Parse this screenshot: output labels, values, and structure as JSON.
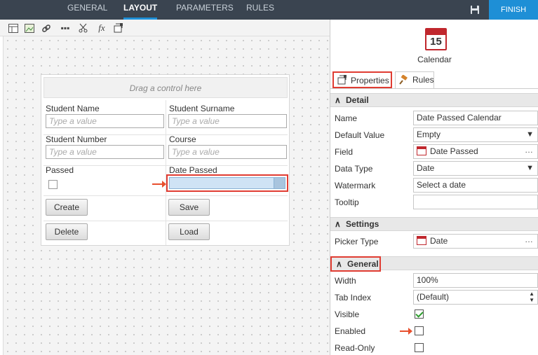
{
  "top_tabs": [
    "GENERAL",
    "LAYOUT",
    "PARAMETERS",
    "RULES"
  ],
  "active_tab": "LAYOUT",
  "finish_label": "FINISH",
  "canvas": {
    "drag_hint": "Drag a control here",
    "fields": [
      {
        "label": "Student Name",
        "placeholder": "Type a value"
      },
      {
        "label": "Student Surname",
        "placeholder": "Type a value"
      },
      {
        "label": "Student Number",
        "placeholder": "Type a value"
      },
      {
        "label": "Course",
        "placeholder": "Type a value"
      }
    ],
    "passed_label": "Passed",
    "date_passed_label": "Date Passed",
    "buttons": [
      "Create",
      "Save",
      "Delete",
      "Load"
    ]
  },
  "panel": {
    "calendar_day": "15",
    "control_title": "Calendar",
    "tabs": [
      "Properties",
      "Rules"
    ],
    "sections": {
      "detail": "Detail",
      "settings": "Settings",
      "general": "General"
    },
    "detail_rows": [
      {
        "label": "Name",
        "value": "Date Passed Calendar"
      },
      {
        "label": "Default Value",
        "value": "Empty"
      },
      {
        "label": "Field",
        "value": "Date Passed"
      },
      {
        "label": "Data Type",
        "value": "Date"
      },
      {
        "label": "Watermark",
        "value": "Select a date"
      },
      {
        "label": "Tooltip",
        "value": ""
      }
    ],
    "settings_rows": [
      {
        "label": "Picker Type",
        "value": "Date"
      }
    ],
    "general_rows": [
      {
        "label": "Width",
        "value": "100%"
      },
      {
        "label": "Tab Index",
        "value": "(Default)"
      },
      {
        "label": "Visible",
        "checked": true
      },
      {
        "label": "Enabled",
        "checked": false
      },
      {
        "label": "Read-Only",
        "checked": false
      }
    ]
  }
}
